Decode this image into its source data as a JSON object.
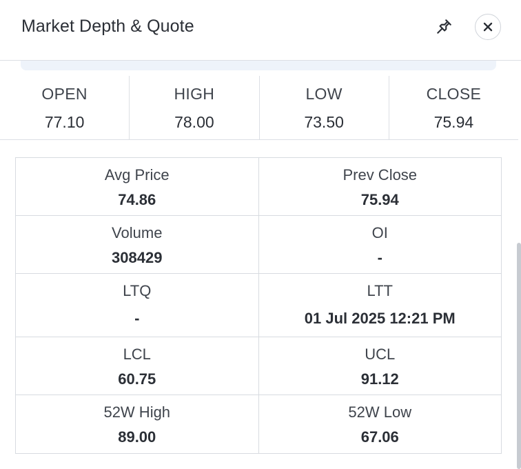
{
  "header": {
    "title": "Market Depth & Quote",
    "pin_icon": "pin-icon",
    "close_icon": "close-icon"
  },
  "ohlc": [
    {
      "label": "OPEN",
      "value": "77.10"
    },
    {
      "label": "HIGH",
      "value": "78.00"
    },
    {
      "label": "LOW",
      "value": "73.50"
    },
    {
      "label": "CLOSE",
      "value": "75.94"
    }
  ],
  "stats": [
    [
      {
        "label": "Avg Price",
        "value": "74.86"
      },
      {
        "label": "Prev Close",
        "value": "75.94"
      }
    ],
    [
      {
        "label": "Volume",
        "value": "308429"
      },
      {
        "label": "OI",
        "value": "-"
      }
    ],
    [
      {
        "label": "LTQ",
        "value": "-"
      },
      {
        "label": "LTT",
        "value": "01 Jul 2025 12:21 PM"
      }
    ],
    [
      {
        "label": "LCL",
        "value": "60.75"
      },
      {
        "label": "UCL",
        "value": "91.12"
      }
    ],
    [
      {
        "label": "52W High",
        "value": "89.00"
      },
      {
        "label": "52W Low",
        "value": "67.06"
      }
    ]
  ],
  "colors": {
    "text": "#2b2f36",
    "border": "#d7dbe0",
    "strip": "#eef3fa"
  }
}
